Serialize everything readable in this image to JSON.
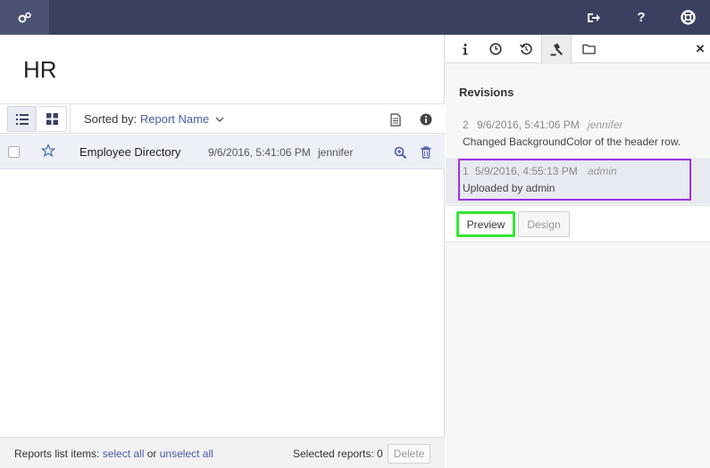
{
  "topbar": {
    "home_icon": "gears-icon",
    "logout_icon": "logout-icon",
    "help_icon": "help-icon",
    "support_icon": "lifebuoy-icon"
  },
  "left": {
    "title": "HR",
    "toolbar": {
      "sorted_label": "Sorted by:",
      "sorted_value": "Report Name"
    },
    "reports": [
      {
        "name": "Employee Directory",
        "date": "9/6/2016, 5:41:06 PM",
        "user": "jennifer"
      }
    ],
    "footer": {
      "list_items_label": "Reports list items:",
      "select_all": "select all",
      "or": "or",
      "unselect_all": "unselect all",
      "selected_label": "Selected reports: 0",
      "delete": "Delete"
    }
  },
  "right": {
    "tabs": [
      "info",
      "history",
      "undo",
      "gavel",
      "folder"
    ],
    "close": "×",
    "revisions_title": "Revisions",
    "revisions": [
      {
        "num": "2",
        "date": "9/6/2016, 5:41:06 PM",
        "user": "jennifer",
        "desc": "Changed BackgroundColor of the header row."
      },
      {
        "num": "1",
        "date": "5/9/2016, 4:55:13 PM",
        "user": "admin",
        "desc": "Uploaded by admin"
      }
    ],
    "preview": "Preview",
    "design": "Design"
  },
  "colors": {
    "topbar": "#3a4160",
    "accent": "#4a5aa8",
    "highlight_purple": "#9b30e8",
    "highlight_green": "#33e633"
  }
}
